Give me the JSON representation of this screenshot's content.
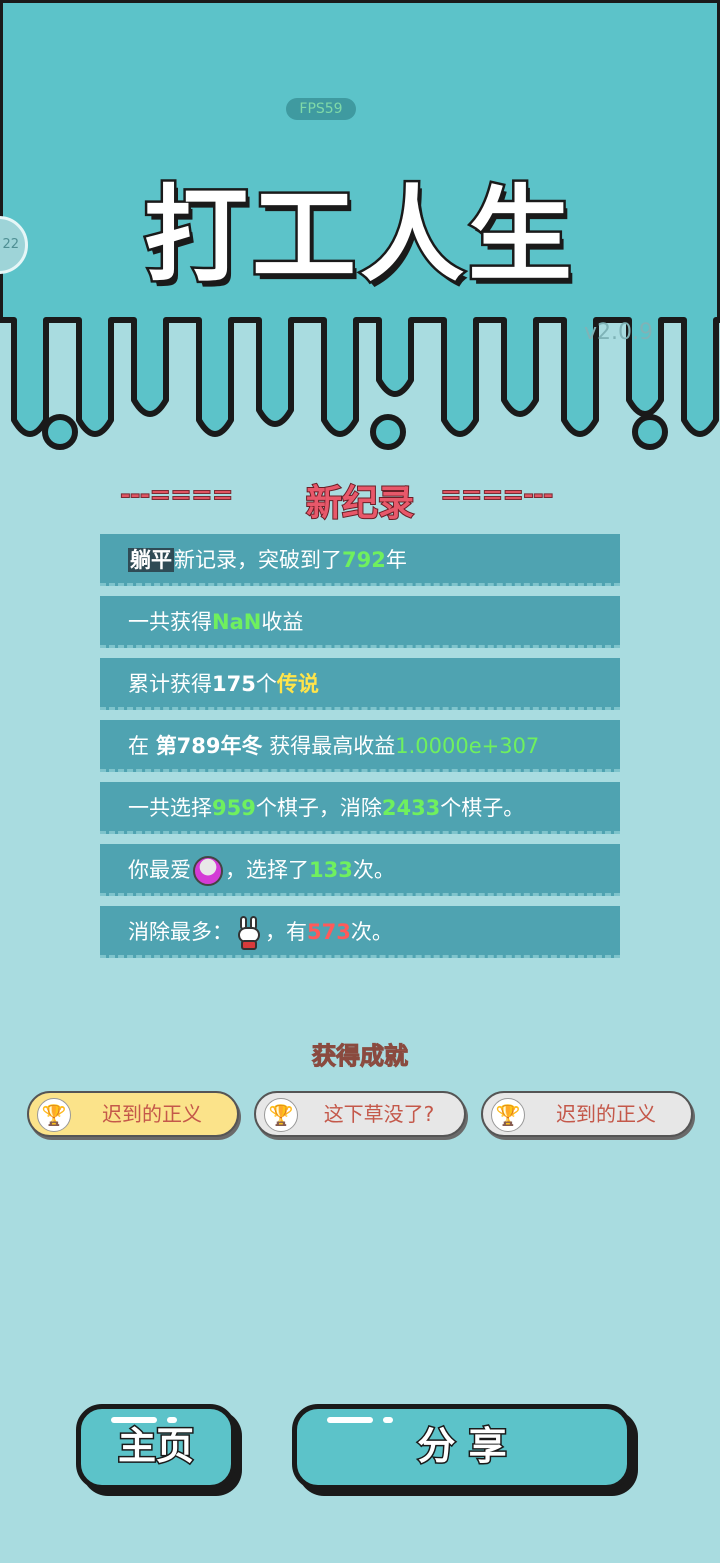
{
  "app": {
    "fps": "FPS59",
    "side_badge": "22",
    "title": "打工人生",
    "version": "v2.0.9"
  },
  "record": {
    "heading": "新纪录",
    "left_deco": "---====",
    "right_deco": "====---",
    "rows": [
      {
        "parts": [
          [
            "躺平",
            "hl"
          ],
          [
            "新记录，突破到了",
            ""
          ],
          [
            "792",
            "g"
          ],
          [
            "年",
            ""
          ]
        ]
      },
      {
        "parts": [
          [
            "一共获得",
            ""
          ],
          [
            "NaN",
            "g"
          ],
          [
            "收益",
            ""
          ]
        ]
      },
      {
        "parts": [
          [
            "累计获得",
            ""
          ],
          [
            "175",
            "b"
          ],
          [
            "个",
            ""
          ],
          [
            "传说",
            "y"
          ]
        ]
      },
      {
        "parts": [
          [
            "在 ",
            ""
          ],
          [
            "第789年冬",
            "b"
          ],
          [
            " 获得最高收益",
            ""
          ],
          [
            "1.0000e+307",
            "gl"
          ]
        ]
      },
      {
        "parts": [
          [
            "一共选择",
            ""
          ],
          [
            "959",
            "g"
          ],
          [
            "个棋子，消除",
            ""
          ],
          [
            "2433",
            "g"
          ],
          [
            "个棋子。",
            ""
          ]
        ]
      },
      {
        "parts": [
          [
            "你最爱",
            ""
          ],
          [
            "pot-icon",
            "icon"
          ],
          [
            "，选择了",
            ""
          ],
          [
            "133",
            "g"
          ],
          [
            "次。",
            ""
          ]
        ]
      },
      {
        "parts": [
          [
            "消除最多：",
            ""
          ],
          [
            "bunny-icon",
            "icon"
          ],
          [
            "，有",
            ""
          ],
          [
            "573",
            "r"
          ],
          [
            "次。",
            ""
          ]
        ]
      }
    ]
  },
  "achievements": {
    "heading": "获得成就",
    "items": [
      {
        "label": "迟到的正义",
        "tier": "gold",
        "icon": "trophy-icon"
      },
      {
        "label": "这下草没了?",
        "tier": "silver",
        "icon": "trophy-icon"
      },
      {
        "label": "迟到的正义",
        "tier": "silver",
        "icon": "trophy-icon"
      }
    ]
  },
  "buttons": {
    "home": "主页",
    "share": "分 享"
  },
  "colors": {
    "header_bg": "#5cc3c9",
    "page_bg": "#a9dce0",
    "row_bg": "#4fa3b1",
    "accent_red": "#e8586a",
    "highlight_green": "#6ff05e",
    "legend_yellow": "#ffe44a"
  }
}
